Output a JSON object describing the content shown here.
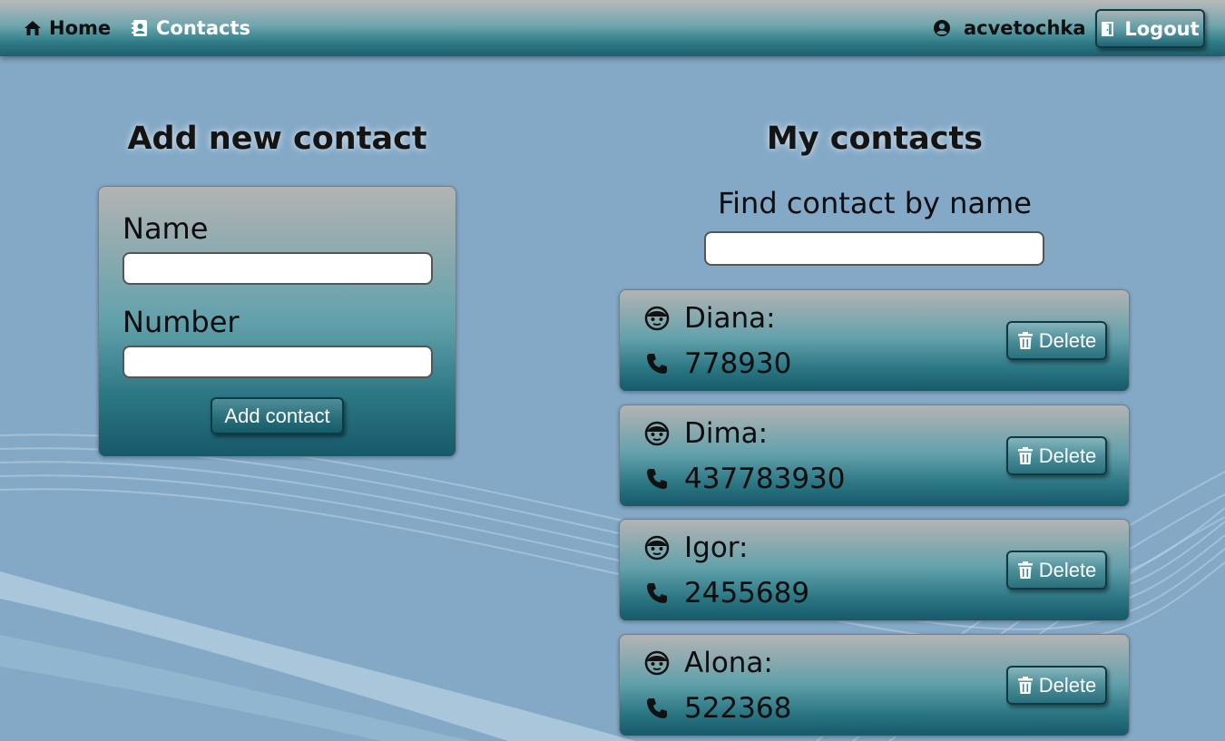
{
  "nav": {
    "home_label": "Home",
    "home_icon": "home-icon",
    "contacts_label": "Contacts",
    "contacts_icon": "address-book-icon",
    "username": "acvetochka",
    "user_icon": "user-circle-icon",
    "logout_label": "Logout",
    "logout_icon": "door-exit-icon"
  },
  "add_form": {
    "title": "Add new contact",
    "name_label": "Name",
    "name_value": "",
    "number_label": "Number",
    "number_value": "",
    "submit_label": "Add contact"
  },
  "contacts": {
    "title": "My contacts",
    "filter_label": "Find contact by name",
    "filter_value": "",
    "items": [
      {
        "name": "Diana:",
        "number": "778930",
        "delete_label": "Delete"
      },
      {
        "name": "Dima:",
        "number": "437783930",
        "delete_label": "Delete"
      },
      {
        "name": "Igor:",
        "number": "2455689",
        "delete_label": "Delete"
      },
      {
        "name": "Alona:",
        "number": "522368",
        "delete_label": "Delete"
      }
    ],
    "name_icon": "face-icon",
    "number_icon": "phone-icon",
    "delete_icon": "trash-icon"
  },
  "colors": {
    "background": "#84a9c7",
    "header_dark": "#1d5f6c",
    "card_light": "#b3b3b3",
    "card_dark": "#17596a",
    "active_nav": "#ffffff"
  }
}
